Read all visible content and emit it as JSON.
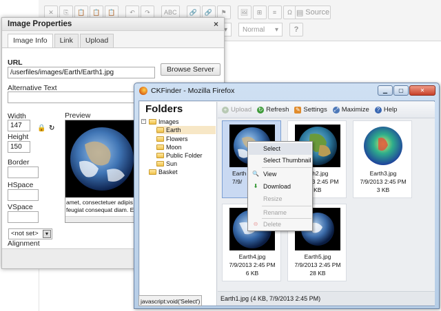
{
  "editor": {
    "toolbar_row1": [
      "✕",
      "⎘",
      "📋",
      "📋",
      "📋",
      "↶",
      "↷",
      "ABC",
      "🔗",
      "🔗",
      "⚑",
      "🖼",
      "⊞",
      "≡",
      "Ω",
      "⛶"
    ],
    "source_label": "Source",
    "style_combo": "",
    "format_combo": "Normal",
    "help_glyph": "?"
  },
  "dialog": {
    "title": "Image Properties",
    "close": "×",
    "tabs": [
      "Image Info",
      "Link",
      "Upload"
    ],
    "url_label": "URL",
    "url_value": "/userfiles/images/Earth/Earth1.jpg",
    "browse_button": "Browse Server",
    "alt_label": "Alternative Text",
    "alt_value": "",
    "width_label": "Width",
    "width_value": "147",
    "height_label": "Height",
    "height_value": "150",
    "border_label": "Border",
    "hspace_label": "HSpace",
    "vspace_label": "VSpace",
    "alignment_label": "Alignment",
    "alignment_value": "<not set>",
    "preview_label": "Preview",
    "preview_text_1": "amet, consectetuer adipis",
    "preview_text_2": "feugiat consequat diam. E",
    "lock_glyph": "🔒",
    "reset_glyph": "↻"
  },
  "finder": {
    "window_title": "CKFinder - Mozilla Firefox",
    "folders_heading": "Folders",
    "tree": {
      "root": "Images",
      "children": [
        "Earth",
        "Flowers",
        "Moon",
        "Public Folder",
        "Sun"
      ],
      "other": "Basket",
      "selected": "Earth"
    },
    "toolbar": {
      "upload": "Upload",
      "refresh": "Refresh",
      "settings": "Settings",
      "maximize": "Maximize",
      "help": "Help"
    },
    "files": [
      {
        "name": "Earth1.jpg",
        "date": "7/9/2013 2:45 PM",
        "size": "4 KB"
      },
      {
        "name": "Earth2.jpg",
        "date": "7/9/2013 2:45 PM",
        "size": "4 KB"
      },
      {
        "name": "Earth3.jpg",
        "date": "7/9/2013 2:45 PM",
        "size": "3 KB"
      },
      {
        "name": "Earth4.jpg",
        "date": "7/9/2013 2:45 PM",
        "size": "6 KB"
      },
      {
        "name": "Earth5.jpg",
        "date": "7/9/2013 2:45 PM",
        "size": "28 KB"
      }
    ],
    "visible_name_1": "Earth",
    "visible_date_1": "7/9/",
    "visible_name_2": "rth2.jpg",
    "visible_date_2": "13 2:45 PM",
    "visible_size_2": "4 KB",
    "status": "Earth1.jpg (4 KB, 7/9/2013 2:45 PM)"
  },
  "context_menu": {
    "select": "Select",
    "select_thumbnail": "Select Thumbnail",
    "view": "View",
    "download": "Download",
    "resize": "Resize",
    "rename": "Rename",
    "delete": "Delete"
  },
  "browser_status": "javascript:void('Select')",
  "colors": {
    "accent": "#7b9fd3",
    "selection": "#c9d9f2",
    "tree_selection": "#f7e7c6"
  }
}
